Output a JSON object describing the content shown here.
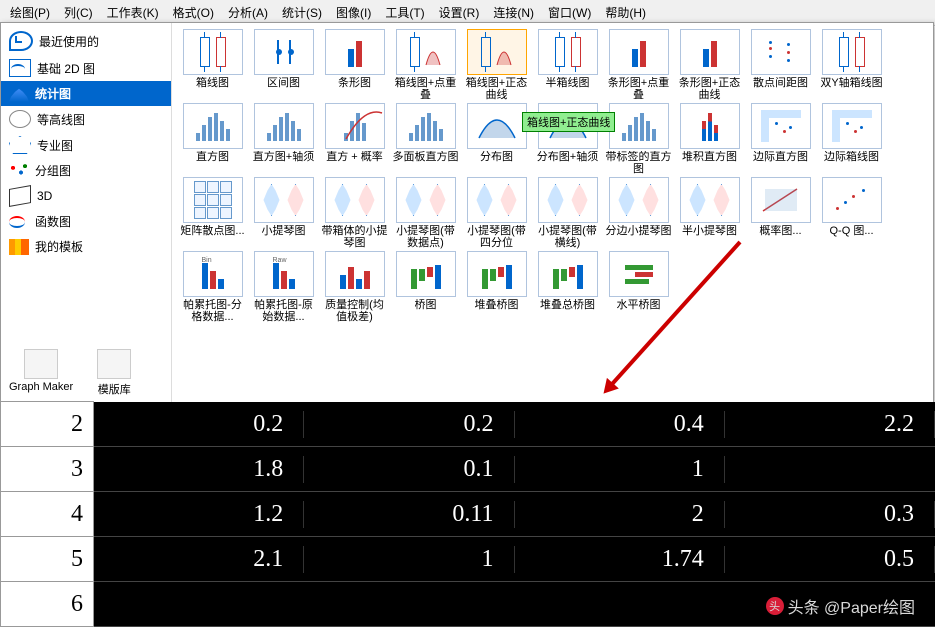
{
  "menu": [
    "绘图(P)",
    "列(C)",
    "工作表(K)",
    "格式(O)",
    "分析(A)",
    "统计(S)",
    "图像(I)",
    "工具(T)",
    "设置(R)",
    "连接(N)",
    "窗口(W)",
    "帮助(H)"
  ],
  "menu_us": [
    "P",
    "C",
    "K",
    "O",
    "A",
    "S",
    "I",
    "T",
    "R",
    "N",
    "W",
    "H"
  ],
  "categories": [
    {
      "label": "最近使用的",
      "icon": "recent"
    },
    {
      "label": "基础 2D 图",
      "icon": "2d"
    },
    {
      "label": "统计图",
      "icon": "stat",
      "selected": true
    },
    {
      "label": "等高线图",
      "icon": "cont"
    },
    {
      "label": "专业图",
      "icon": "pro"
    },
    {
      "label": "分组图",
      "icon": "grp"
    },
    {
      "label": "3D",
      "icon": "3d"
    },
    {
      "label": "函数图",
      "icon": "fn"
    },
    {
      "label": "我的模板",
      "icon": "tpl"
    }
  ],
  "tools": [
    {
      "label": "Graph Maker"
    },
    {
      "label": "模版库"
    }
  ],
  "tooltip": "箱线图+正态曲线",
  "chart_rows": [
    [
      {
        "name": "箱线图",
        "t": "box"
      },
      {
        "name": "区间图",
        "t": "interval"
      },
      {
        "name": "条形图",
        "t": "bar"
      },
      {
        "name": "箱线图+点重叠",
        "t": "boxdot"
      },
      {
        "name": "箱线图+正态曲线",
        "t": "boxnorm",
        "hover": true
      },
      {
        "name": "半箱线图",
        "t": "halfbox"
      },
      {
        "name": "条形图+点重叠",
        "t": "bardot"
      },
      {
        "name": "条形图+正态曲线",
        "t": "barnorm"
      },
      {
        "name": "散点间距图",
        "t": "scatspace"
      },
      {
        "name": "双Y轴箱线图",
        "t": "box2y"
      }
    ],
    [
      {
        "name": "直方图",
        "t": "hist"
      },
      {
        "name": "直方图+轴须",
        "t": "histrug"
      },
      {
        "name": "直方 + 概率",
        "t": "histprob"
      },
      {
        "name": "多面板直方图",
        "t": "histpanel"
      },
      {
        "name": "分布图",
        "t": "dist"
      },
      {
        "name": "分布图+轴须",
        "t": "distrug"
      },
      {
        "name": "带标签的直方图",
        "t": "histlbl"
      },
      {
        "name": "堆积直方图",
        "t": "histstk"
      },
      {
        "name": "边际直方图",
        "t": "histmarg"
      },
      {
        "name": "边际箱线图",
        "t": "boxmarg"
      }
    ],
    [
      {
        "name": "矩阵散点图...",
        "t": "matscat"
      },
      {
        "name": "小提琴图",
        "t": "violin"
      },
      {
        "name": "带箱体的小提琴图",
        "t": "violinbox"
      },
      {
        "name": "小提琴图(带数据点)",
        "t": "violindot"
      },
      {
        "name": "小提琴图(带四分位",
        "t": "violinq"
      },
      {
        "name": "小提琴图(带横线)",
        "t": "violinmed"
      },
      {
        "name": "分边小提琴图",
        "t": "violinsplit"
      },
      {
        "name": "半小提琴图",
        "t": "violinhalf"
      },
      {
        "name": "概率图...",
        "t": "prob"
      },
      {
        "name": "Q-Q 图...",
        "t": "qq"
      }
    ],
    [
      {
        "name": "帕累托图-分格数据...",
        "t": "pareto1"
      },
      {
        "name": "帕累托图-原始数据...",
        "t": "pareto2"
      },
      {
        "name": "质量控制(均值极差)",
        "t": "qc"
      },
      {
        "name": "桥图",
        "t": "bridge"
      },
      {
        "name": "堆叠桥图",
        "t": "bridgestk"
      },
      {
        "name": "堆叠总桥图",
        "t": "bridgetot"
      },
      {
        "name": "水平桥图",
        "t": "bridgeh"
      }
    ]
  ],
  "table": {
    "rows": [
      {
        "h": "2",
        "c": [
          "0.2",
          "0.2",
          "0.4",
          "2.2"
        ]
      },
      {
        "h": "3",
        "c": [
          "1.8",
          "0.1",
          "1",
          ""
        ]
      },
      {
        "h": "4",
        "c": [
          "1.2",
          "0.11",
          "2",
          "0.3"
        ]
      },
      {
        "h": "5",
        "c": [
          "2.1",
          "1",
          "1.74",
          "0.5"
        ]
      },
      {
        "h": "6",
        "c": [
          "",
          "",
          "",
          ""
        ]
      }
    ]
  },
  "watermark": "头条 @Paper绘图"
}
